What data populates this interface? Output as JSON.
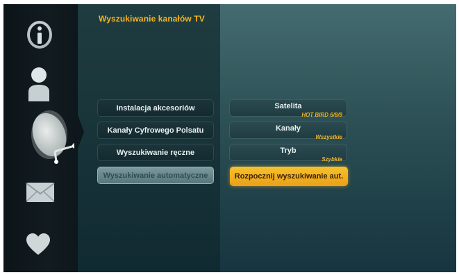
{
  "header": {
    "title": "Wyszukiwanie kanałów TV"
  },
  "sidebar": {
    "items": [
      {
        "icon": "info-icon"
      },
      {
        "icon": "user-icon"
      },
      {
        "icon": "satellite-dish-icon",
        "selected": true
      },
      {
        "icon": "envelope-icon"
      },
      {
        "icon": "heart-icon"
      }
    ]
  },
  "menu": {
    "items": [
      {
        "label": "Instalacja akcesoriów"
      },
      {
        "label": "Kanały Cyfrowego Polsatu"
      },
      {
        "label": "Wyszukiwanie ręczne"
      },
      {
        "label": "Wyszukiwanie automatyczne",
        "active": true
      }
    ]
  },
  "options": {
    "satellite": {
      "label": "Satelita",
      "value": "HOT BIRD 6/8/9"
    },
    "channels": {
      "label": "Kanały",
      "value": "Wszystkie"
    },
    "mode": {
      "label": "Tryb",
      "value": "Szybkie"
    }
  },
  "action": {
    "start_label": "Rozpocznij wyszukiwanie aut."
  },
  "colors": {
    "accent": "#f5b520",
    "background": "#17323a"
  }
}
